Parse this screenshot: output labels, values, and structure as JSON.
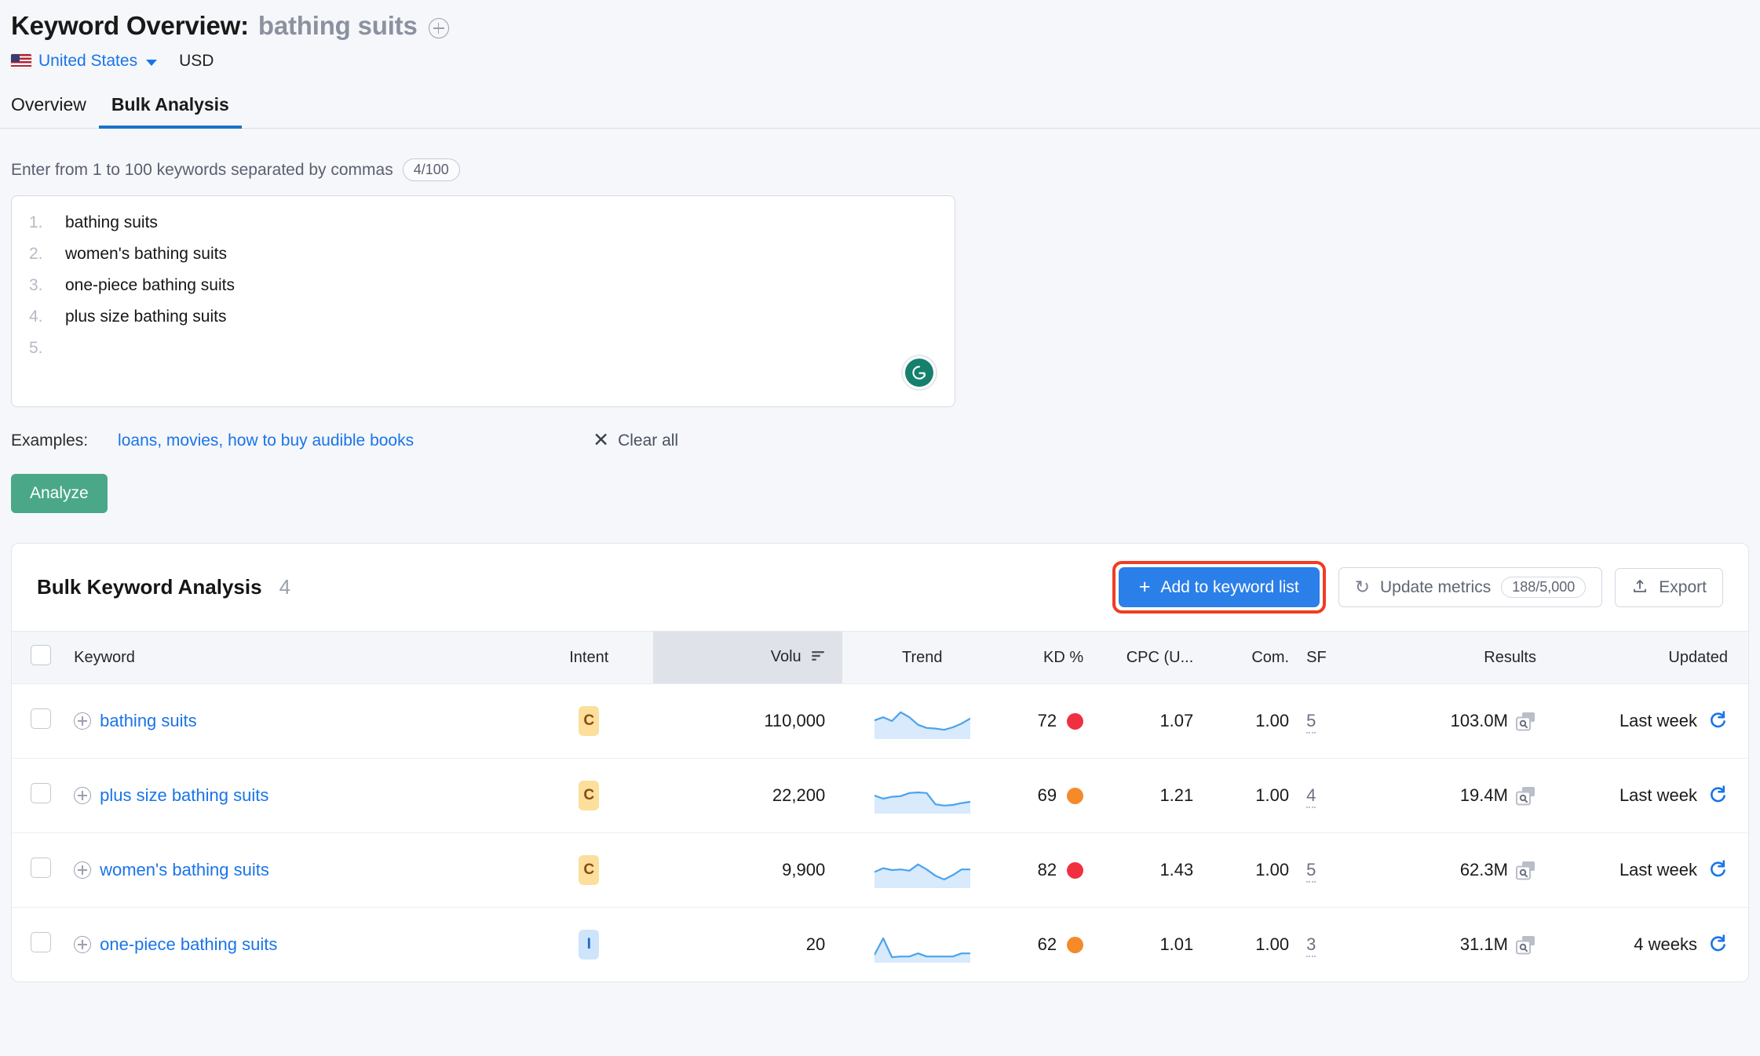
{
  "header": {
    "title_prefix": "Keyword Overview:",
    "keyword": "bathing suits",
    "add_icon": "plus-circle-icon",
    "country": "United States",
    "currency": "USD",
    "tabs": [
      {
        "label": "Overview",
        "active": false
      },
      {
        "label": "Bulk Analysis",
        "active": true
      }
    ]
  },
  "input": {
    "hint": "Enter from 1 to 100 keywords separated by commas",
    "counter": "4/100",
    "keywords": [
      {
        "num": "1.",
        "text": "bathing suits"
      },
      {
        "num": "2.",
        "text": "women's bathing suits"
      },
      {
        "num": "3.",
        "text": "one-piece bathing suits"
      },
      {
        "num": "4.",
        "text": "plus size bathing suits"
      },
      {
        "num": "5.",
        "text": ""
      }
    ],
    "grammarly_icon": "grammarly-icon",
    "examples_label": "Examples:",
    "examples_links": "loans, movies, how to buy audible books",
    "clear_all": "Clear all",
    "clear_icon": "close-icon",
    "analyze_button": "Analyze"
  },
  "card": {
    "title": "Bulk Keyword Analysis",
    "count": "4",
    "add_to_list_button": "Add to keyword list",
    "add_icon": "plus-icon",
    "update_metrics_button": "Update metrics",
    "update_icon": "refresh-icon",
    "metrics_quota": "188/5,000",
    "export_button": "Export",
    "export_icon": "upload-icon",
    "highlight_color": "#f03c23",
    "accent_blue": "#2b7fe8"
  },
  "table": {
    "columns": [
      {
        "key": "check",
        "label": ""
      },
      {
        "key": "kw",
        "label": "Keyword"
      },
      {
        "key": "intent",
        "label": "Intent"
      },
      {
        "key": "vol",
        "label": "Volu",
        "sorted": true
      },
      {
        "key": "trend",
        "label": "Trend"
      },
      {
        "key": "kd",
        "label": "KD %"
      },
      {
        "key": "cpc",
        "label": "CPC (U..."
      },
      {
        "key": "com",
        "label": "Com."
      },
      {
        "key": "sf",
        "label": "SF"
      },
      {
        "key": "res",
        "label": "Results"
      },
      {
        "key": "upd",
        "label": "Updated"
      }
    ],
    "rows": [
      {
        "keyword": "bathing suits",
        "intent": "C",
        "volume": "110,000",
        "trend": [
          0.52,
          0.62,
          0.5,
          0.78,
          0.62,
          0.38,
          0.28,
          0.26,
          0.22,
          0.3,
          0.42,
          0.58
        ],
        "kd": "72",
        "kd_color": "#f03040",
        "cpc": "1.07",
        "com": "1.00",
        "sf": "5",
        "results": "103.0M",
        "updated": "Last week"
      },
      {
        "keyword": "plus size bathing suits",
        "intent": "C",
        "volume": "22,200",
        "trend": [
          0.5,
          0.4,
          0.46,
          0.48,
          0.58,
          0.6,
          0.58,
          0.22,
          0.18,
          0.2,
          0.26,
          0.3
        ],
        "kd": "69",
        "kd_color": "#f58a2b",
        "cpc": "1.21",
        "com": "1.00",
        "sf": "4",
        "results": "19.4M",
        "updated": "Last week"
      },
      {
        "keyword": "women's bathing suits",
        "intent": "C",
        "volume": "9,900",
        "trend": [
          0.44,
          0.56,
          0.5,
          0.52,
          0.48,
          0.68,
          0.52,
          0.32,
          0.2,
          0.34,
          0.52,
          0.52
        ],
        "kd": "82",
        "kd_color": "#f03040",
        "cpc": "1.43",
        "com": "1.00",
        "sf": "5",
        "results": "62.3M",
        "updated": "Last week"
      },
      {
        "keyword": "one-piece bathing suits",
        "intent": "I",
        "volume": "20",
        "trend": [
          0.18,
          0.7,
          0.1,
          0.12,
          0.12,
          0.22,
          0.12,
          0.12,
          0.12,
          0.12,
          0.22,
          0.22
        ],
        "kd": "62",
        "kd_color": "#f58a2b",
        "cpc": "1.01",
        "com": "1.00",
        "sf": "3",
        "results": "31.1M",
        "updated": "4 weeks"
      }
    ]
  }
}
